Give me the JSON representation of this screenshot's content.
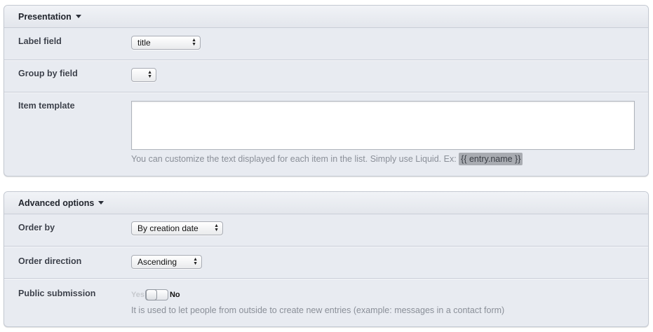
{
  "presentation": {
    "title": "Presentation",
    "label_field": {
      "label": "Label field",
      "value": "title"
    },
    "group_by_field": {
      "label": "Group by field",
      "value": ""
    },
    "item_template": {
      "label": "Item template",
      "value": "",
      "hint": "You can customize the text displayed for each item in the list. Simply use Liquid. Ex:",
      "hint_code": "{{ entry.name }}"
    }
  },
  "advanced": {
    "title": "Advanced options",
    "order_by": {
      "label": "Order by",
      "value": "By creation date"
    },
    "order_direction": {
      "label": "Order direction",
      "value": "Ascending"
    },
    "public_submission": {
      "label": "Public submission",
      "yes": "Yes",
      "no": "No",
      "state": "No",
      "hint": "It is used to let people from outside to create new entries (example: messages in a contact form)"
    }
  }
}
